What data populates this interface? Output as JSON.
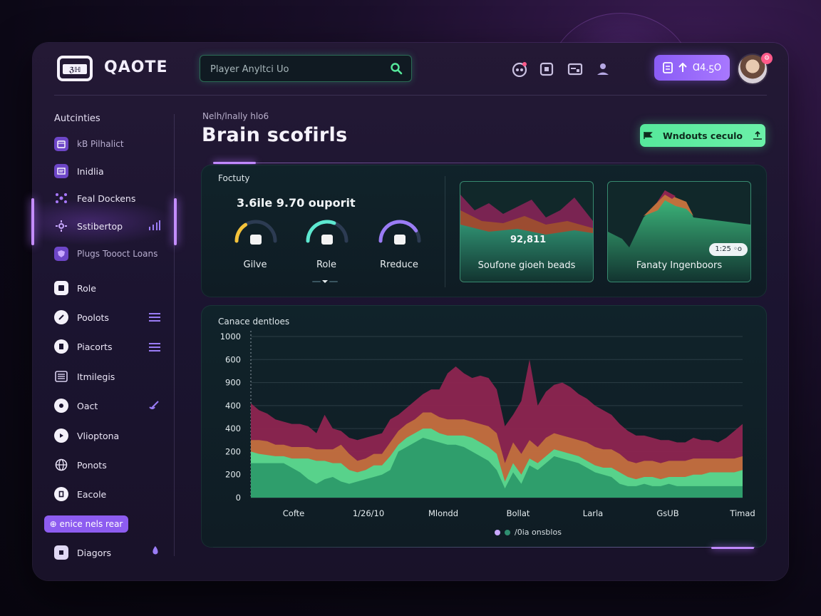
{
  "app": {
    "brand": "QAOTE",
    "logo_text": "ℨℍ"
  },
  "header": {
    "search_placeholder": "Player Anyltci Uo",
    "cta_label": "Ɑ4.ƽO",
    "avatar_badge": "⚙"
  },
  "sidebar": {
    "title": "Autcinties",
    "items": [
      {
        "label": "kB Pilhalict",
        "icon": "calendar-icon"
      },
      {
        "label": "Inidlia",
        "icon": "document-icon"
      },
      {
        "label": "Feal Dockens",
        "icon": "network-icon"
      },
      {
        "label": "Sstibertop",
        "icon": "gear-cluster-icon"
      },
      {
        "label": "Plugs Toooct Loans",
        "icon": "shield-icon"
      },
      {
        "label": "Role",
        "icon": "box-icon"
      },
      {
        "label": "Poolots",
        "icon": "pen-icon"
      },
      {
        "label": "Piacorts",
        "icon": "bookmark-icon"
      },
      {
        "label": "Itmilegis",
        "icon": "list-icon"
      },
      {
        "label": "Oact",
        "icon": "chat-icon"
      },
      {
        "label": "Vlioptona",
        "icon": "play-icon"
      },
      {
        "label": "Ponots",
        "icon": "globe-icon"
      },
      {
        "label": "Eacole",
        "icon": "e-icon"
      },
      {
        "label": "Diagors",
        "icon": "diagram-icon"
      }
    ],
    "pill_label": "⊕ enice nels rear"
  },
  "main": {
    "breadcrumb": "Nelh/lnally hlo6",
    "title": "Brain scofirls",
    "green_button": "Wndouts ceculo",
    "summary": {
      "label": "Foctuty",
      "big_stat": "3.6ile 9.70 ouporit",
      "gauges": [
        {
          "label": "Gilve",
          "value": 0.32,
          "color": "#f5c33a"
        },
        {
          "label": "Role",
          "value": 0.62,
          "color": "#5de8d0"
        },
        {
          "label": "Rreduce",
          "value": 0.82,
          "color": "#9a7cf5"
        }
      ],
      "mini_cards": [
        {
          "label": "Soufone gioeh beads",
          "value": "92,811"
        },
        {
          "label": "Fanaty Ingenboors",
          "chip": "1:25 ◦o"
        }
      ]
    },
    "chart_card": {
      "label": "Canace dentloes",
      "legend": "/0ia onsblos"
    }
  },
  "colors": {
    "accent_purple": "#a878ff",
    "accent_green": "#56e89b",
    "series_red": "#8e2550",
    "series_orange": "#c0703d",
    "series_green": "#3fbf80"
  },
  "chart_data": {
    "type": "area",
    "title": "Canace dentloes",
    "xlabel": "",
    "ylabel": "",
    "y_tick_labels": [
      "0",
      "200",
      "200",
      "400",
      "400",
      "900",
      "600",
      "1000"
    ],
    "ylim": [
      0,
      7
    ],
    "x_tick_labels": [
      "Cofte",
      "1/26/10",
      "Mlondd",
      "Bollat",
      "Larla",
      "GsUB",
      "Timad"
    ],
    "grid": true,
    "legend": "bottom",
    "x": [
      0,
      0.25,
      0.5,
      0.75,
      1,
      1.25,
      1.5,
      1.75,
      2,
      2.25,
      2.5,
      2.75,
      3,
      3.25,
      3.5,
      3.75,
      4,
      4.25,
      4.5,
      4.75,
      5,
      5.25,
      5.5,
      5.75,
      6,
      6.25,
      6.5,
      6.75,
      7,
      7.25,
      7.5,
      7.75,
      8,
      8.25,
      8.5,
      8.75,
      9,
      9.25,
      9.5,
      9.75,
      10,
      10.25,
      10.5,
      10.75,
      11,
      11.25,
      11.5,
      11.75,
      12,
      12.25,
      12.5,
      12.75,
      13,
      13.25,
      13.5,
      13.75,
      14,
      14.25,
      14.5,
      14.75,
      15
    ],
    "series": [
      {
        "values": [
          1.5,
          1.5,
          1.5,
          1.5,
          1.5,
          1.3,
          1.1,
          0.8,
          0.6,
          0.8,
          0.9,
          0.7,
          0.6,
          0.7,
          0.8,
          0.9,
          1,
          1.2,
          2,
          2.2,
          2.4,
          2.6,
          2.5,
          2.4,
          2.3,
          2.3,
          2.2,
          2,
          1.8,
          1.6,
          1.2,
          0.4,
          1.1,
          0.6,
          1.4,
          1.2,
          1.5,
          1.8,
          1.7,
          1.6,
          1.5,
          1.3,
          1.1,
          1,
          0.9,
          0.6,
          0.5,
          0.5,
          0.6,
          0.5,
          0.5,
          0.6,
          0.5,
          0.5,
          0.5,
          0.5,
          0.5,
          0.5,
          0.5,
          0.5,
          0.5
        ]
      },
      {
        "values": [
          0.5,
          0.4,
          0.35,
          0.3,
          0.3,
          0.4,
          0.6,
          0.9,
          1.0,
          0.8,
          0.6,
          0.8,
          0.6,
          0.4,
          0.4,
          0.5,
          0.4,
          0.6,
          0.3,
          0.4,
          0.4,
          0.4,
          0.5,
          0.4,
          0.4,
          0.4,
          0.5,
          0.6,
          0.6,
          0.6,
          0.7,
          0.3,
          0.4,
          0.4,
          0.3,
          0.3,
          0.3,
          0.3,
          0.3,
          0.3,
          0.3,
          0.3,
          0.3,
          0.3,
          0.4,
          0.5,
          0.4,
          0.3,
          0.3,
          0.4,
          0.3,
          0.3,
          0.4,
          0.4,
          0.5,
          0.5,
          0.6,
          0.6,
          0.6,
          0.6,
          0.7
        ]
      },
      {
        "values": [
          0.5,
          0.6,
          0.6,
          0.5,
          0.5,
          0.5,
          0.5,
          0.5,
          0.5,
          0.5,
          0.6,
          0.8,
          0.7,
          0.5,
          0.5,
          0.5,
          0.5,
          0.6,
          0.6,
          0.6,
          0.6,
          0.7,
          0.7,
          0.7,
          0.7,
          0.7,
          0.7,
          0.7,
          0.8,
          0.9,
          0.9,
          0.8,
          0.9,
          0.9,
          0.8,
          0.7,
          0.8,
          0.7,
          0.7,
          0.7,
          0.7,
          0.8,
          0.8,
          0.8,
          0.8,
          0.8,
          0.7,
          0.7,
          0.7,
          0.7,
          0.7,
          0.7,
          0.7,
          0.7,
          0.7,
          0.7,
          0.6,
          0.6,
          0.6,
          0.6,
          0.6
        ]
      },
      {
        "values": [
          1.6,
          1.3,
          1.2,
          1.1,
          1.0,
          1.0,
          1.0,
          0.9,
          0.7,
          1.5,
          0.9,
          0.6,
          0.7,
          0.9,
          0.9,
          0.8,
          0.9,
          1.0,
          0.7,
          0.7,
          0.8,
          0.8,
          1.0,
          1.2,
          2.0,
          2.3,
          2.0,
          1.9,
          2.1,
          2.1,
          1.9,
          1.6,
          1.2,
          2.3,
          3.5,
          1.8,
          2.0,
          2.1,
          2.3,
          2.2,
          2.0,
          1.9,
          1.8,
          1.7,
          1.5,
          1.3,
          1.3,
          1.2,
          1.1,
          1.0,
          1.0,
          0.9,
          0.8,
          0.8,
          0.9,
          0.8,
          0.8,
          0.7,
          0.9,
          1.2,
          1.4
        ]
      }
    ]
  }
}
